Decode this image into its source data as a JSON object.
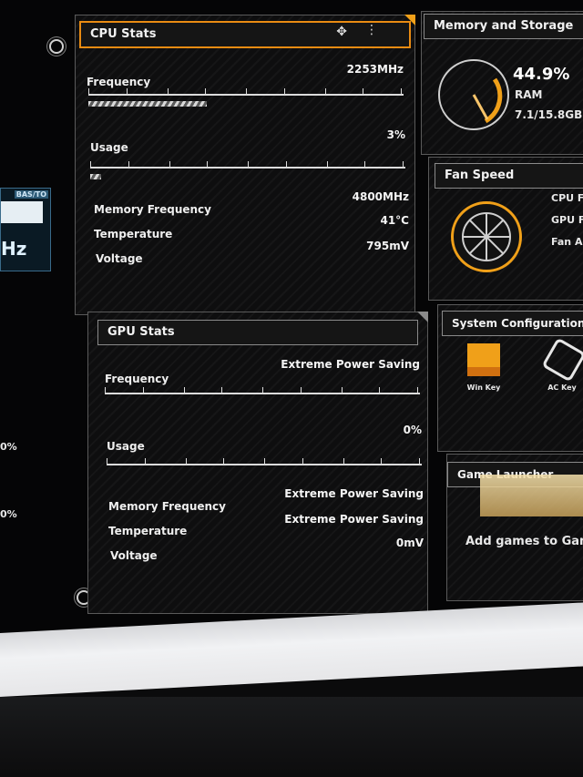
{
  "cpu": {
    "title": "CPU Stats",
    "frequency_label": "Frequency",
    "frequency_value": "2253MHz",
    "usage_label": "Usage",
    "usage_value": "3%",
    "usage_fraction": 0.03,
    "mem_freq_label": "Memory Frequency",
    "mem_freq_value": "4800MHz",
    "temp_label": "Temperature",
    "temp_value": "41°C",
    "voltage_label": "Voltage",
    "voltage_value": "795mV"
  },
  "gpu": {
    "title": "GPU Stats",
    "frequency_label": "Frequency",
    "frequency_value": "Extreme Power Saving",
    "usage_label": "Usage",
    "usage_value": "0%",
    "mem_freq_label": "Memory Frequency",
    "mem_freq_value": "Extreme Power Saving",
    "temp_label": "Temperature",
    "temp_value": "Extreme Power Saving",
    "voltage_label": "Voltage",
    "voltage_value": "0mV"
  },
  "memory": {
    "title": "Memory and Storage",
    "percent": "44.9%",
    "label": "RAM",
    "detail": "7.1/15.8GB",
    "fraction": 0.449
  },
  "fan": {
    "title": "Fan Speed",
    "items": [
      "CPU Fa",
      "GPU Fa",
      "Fan Ac"
    ]
  },
  "system": {
    "title": "System Configuration",
    "items": [
      {
        "label": "Win Key"
      },
      {
        "label": "AC Key"
      }
    ]
  },
  "games": {
    "title": "Game Launcher",
    "add_text": "Add games to Gam"
  },
  "left": {
    "widget_badge": "BAS/TO",
    "widget_text": "Hz",
    "pct_1": "0%",
    "pct_2": "0%"
  },
  "colors": {
    "accent": "#f0a019",
    "panel_bg": "#0e0e0f"
  },
  "icons": {
    "move": "move-icon",
    "menu": "kebab-menu-icon",
    "settings": "settings-icon"
  }
}
